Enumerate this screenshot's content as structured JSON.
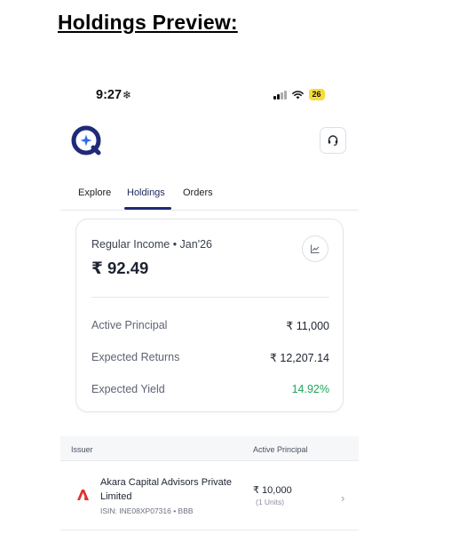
{
  "heading": "Holdings Preview:",
  "status_bar": {
    "time": "9:27",
    "time_icon": "snowflake-icon",
    "battery": "26"
  },
  "header": {
    "logo": "app-logo-icon",
    "support_icon": "headset-icon"
  },
  "tabs": [
    {
      "label": "Explore",
      "active": false
    },
    {
      "label": "Holdings",
      "active": true
    },
    {
      "label": "Orders",
      "active": false
    }
  ],
  "summary": {
    "title": "Regular Income • Jan'26",
    "amount": "₹ 92.49",
    "chart_icon": "trend-chart-icon",
    "rows": [
      {
        "label": "Active Principal",
        "value": "₹ 11,000"
      },
      {
        "label": "Expected Returns",
        "value": "₹ 12,207.14"
      },
      {
        "label": "Expected Yield",
        "value": "14.92%"
      }
    ]
  },
  "table": {
    "headers": {
      "issuer": "Issuer",
      "principal": "Active Principal"
    },
    "rows": [
      {
        "issuer": "Akara Capital Advisors Private Limited",
        "isin": "ISIN: INE08XP07316 • BBB",
        "principal": "₹ 10,000",
        "units": "(1 Units)",
        "logo": "akara-logo-icon"
      }
    ]
  },
  "colors": {
    "accent": "#1f2a78",
    "positive": "#1fa65a",
    "battery": "#f7dc38"
  }
}
